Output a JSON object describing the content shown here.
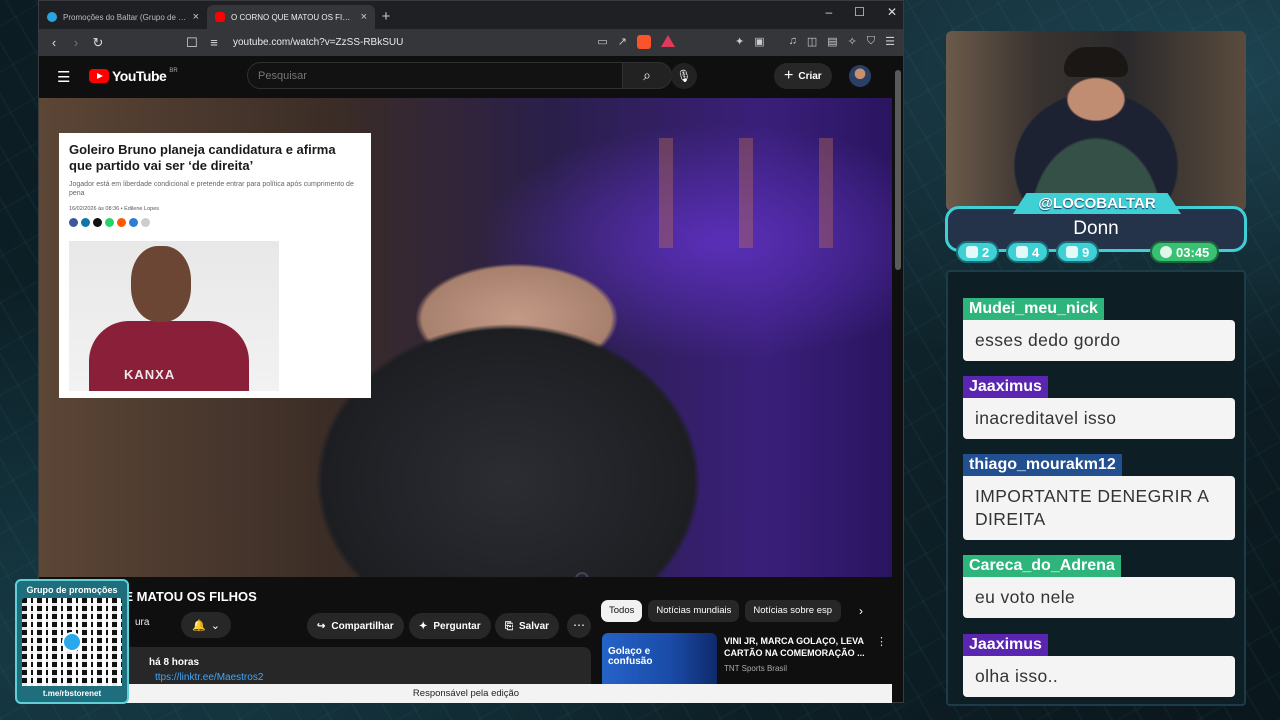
{
  "browser": {
    "tabs": [
      {
        "title": "Promoções do Baltar (Grupo de comentários)",
        "icon_color": "#2aa3df"
      },
      {
        "title": "O CORNO QUE MATOU OS FILHOS - YouTube",
        "icon_color": "#ff0000"
      }
    ],
    "new_tab": "+",
    "window_controls": [
      "–",
      "☐",
      "✕"
    ],
    "url": "youtube.com/watch?v=ZzSS-RBkSUU",
    "badge_count": "1"
  },
  "youtube": {
    "logo": "YouTube",
    "region": "BR",
    "search_placeholder": "Pesquisar",
    "create_label": "Criar",
    "video": {
      "article": {
        "headline": "Goleiro Bruno planeja candidatura e afirma que partido vai ser ‘de direita’",
        "subtitle": "Jogador está em liberdade condicional e pretende entrar para política após cumprimento de pena",
        "meta": "16/02/2026 às 08:36 • Edilene Lopes",
        "shirt_text": "KANXA"
      }
    },
    "title_visible": "UE MATOU OS FILHOS",
    "channel_visible": "ura",
    "actions": {
      "share": "Compartilhar",
      "ask": "Perguntar",
      "save": "Salvar"
    },
    "description": {
      "age": "há 8 horas",
      "link": "ttps://linktr.ee/Maestros2"
    },
    "chips": [
      "Todos",
      "Notícias mundiais",
      "Notícias sobre esp"
    ],
    "recommended": {
      "title": "VINI JR, MARCA GOLAÇO, LEVA CARTÃO NA COMEMORAÇÃO ...",
      "channel": "TNT Sports Brasil",
      "thumb_text": "Golaço e confusão"
    },
    "tooltip": "Responsável pela edição"
  },
  "overlay": {
    "qr": {
      "heading": "Grupo de promoções",
      "url": "t.me/rbstorenet"
    },
    "streamer": {
      "handle": "@LOCOBALTAR",
      "name": "Donn"
    },
    "stats": {
      "twitch": "2",
      "youtube": "4",
      "kick": "9",
      "time": "03:45"
    },
    "chat": [
      {
        "user": "Mudei_meu_nick",
        "text": "esses dedo gordo",
        "color": "#2db57c"
      },
      {
        "user": "Jaaximus",
        "text": "inacreditavel isso",
        "color": "#5a25b0"
      },
      {
        "user": "thiago_mourakm12",
        "text": "IMPORTANTE DENEGRIR A DIREITA",
        "color": "#214f8f"
      },
      {
        "user": "Careca_do_Adrena",
        "text": "eu voto nele",
        "color": "#2db57c"
      },
      {
        "user": "Jaaximus",
        "text": "olha isso..",
        "color": "#5a25b0"
      }
    ]
  }
}
